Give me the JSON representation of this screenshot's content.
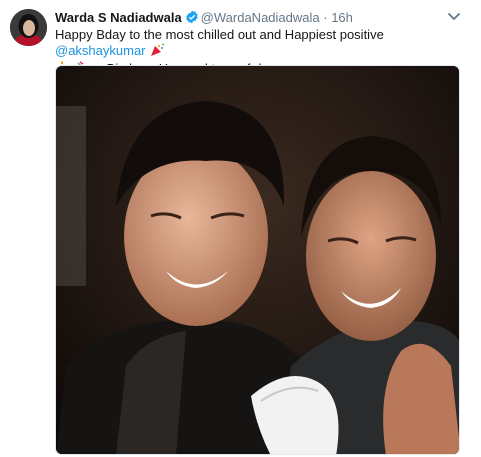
{
  "tweet": {
    "author_name": "Warda S Nadiadwala",
    "handle": "@WardaNadiadwala",
    "separator": "·",
    "time": "16h",
    "text_part1": "Happy Bday to the most chilled out and Happiest positive ",
    "mention": "@akshaykumar",
    "text_part2": "..... Big bear Hug and tons of duas",
    "emojis": [
      "party-popper-icon",
      "cake-icon",
      "confetti-icon"
    ]
  },
  "icons": {
    "verified": "verified-badge-icon",
    "caret": "chevron-down-icon"
  },
  "colors": {
    "link": "#1b95e0",
    "verified": "#1da1f2",
    "muted": "#657786",
    "text": "#14171a"
  }
}
